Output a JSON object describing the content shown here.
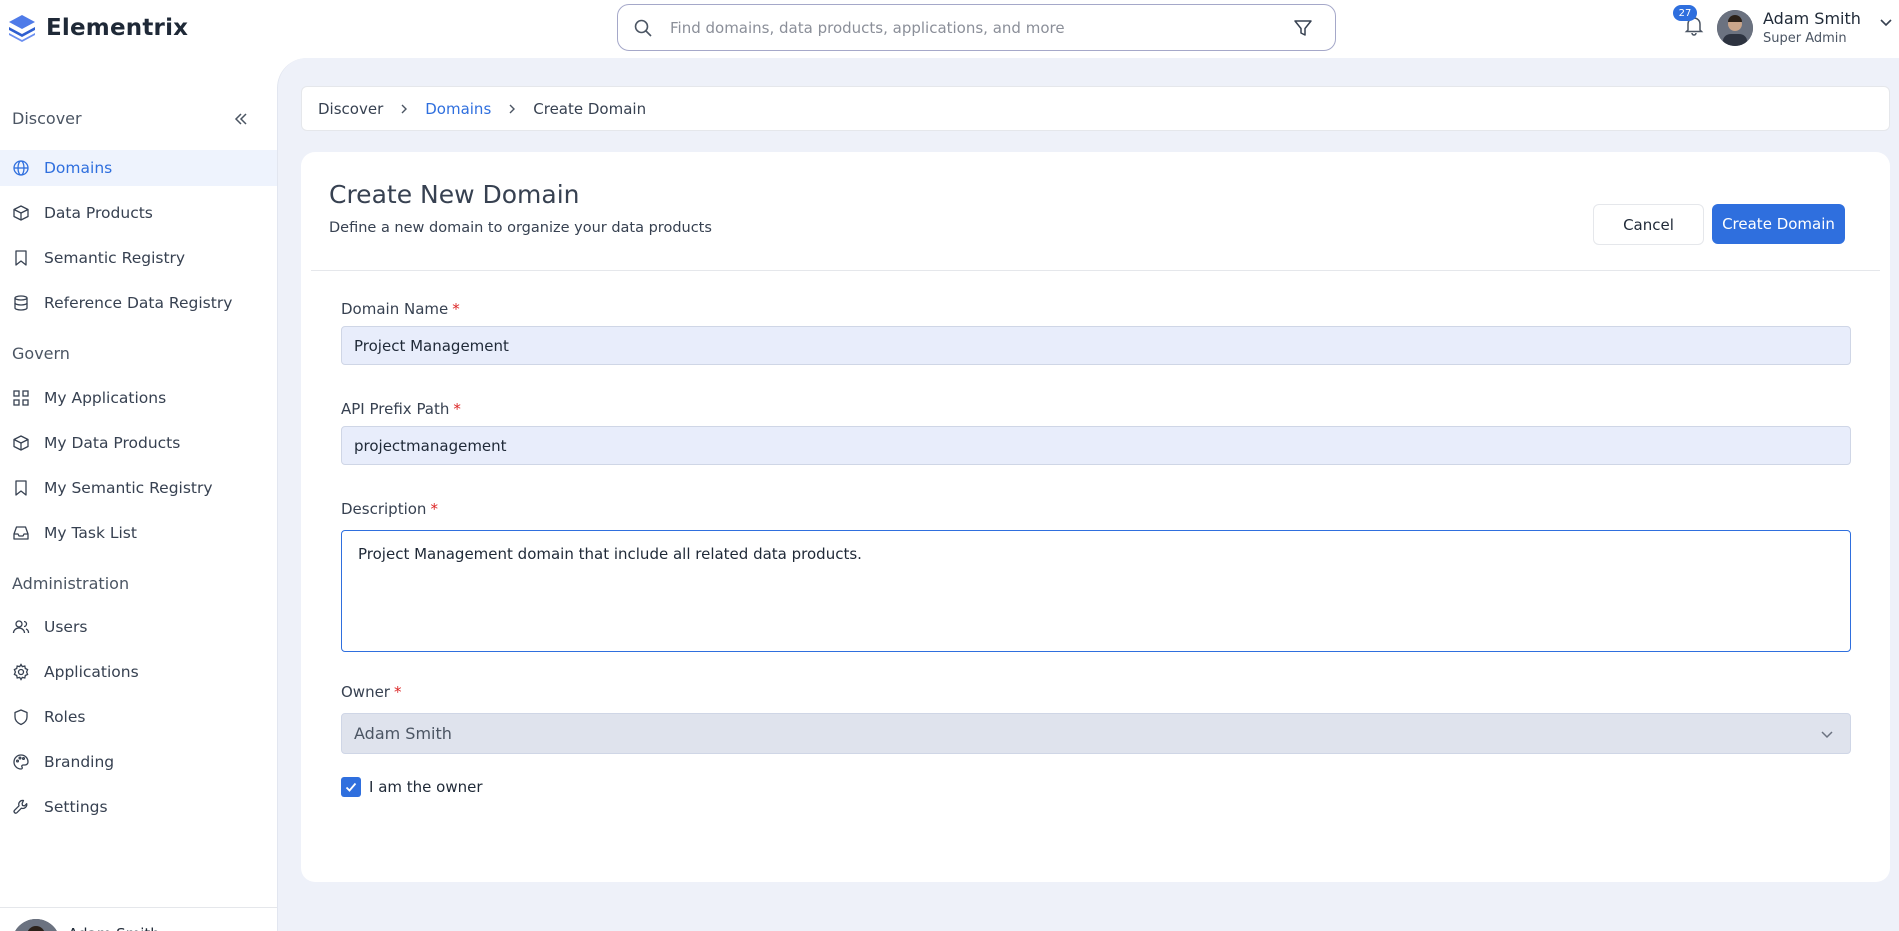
{
  "app": {
    "name": "Elementrix"
  },
  "search": {
    "placeholder": "Find domains, data products, applications, and more"
  },
  "notifications": {
    "count": "27"
  },
  "user": {
    "name": "Adam Smith",
    "role": "Super Admin"
  },
  "sidebar": {
    "sections": [
      {
        "title": "Discover",
        "items": [
          {
            "label": "Domains",
            "icon": "globe-icon",
            "active": true
          },
          {
            "label": "Data Products",
            "icon": "cube-icon"
          },
          {
            "label": "Semantic Registry",
            "icon": "bookmark-icon"
          },
          {
            "label": "Reference Data Registry",
            "icon": "database-icon"
          }
        ]
      },
      {
        "title": "Govern",
        "items": [
          {
            "label": "My Applications",
            "icon": "grid-icon"
          },
          {
            "label": "My Data Products",
            "icon": "cube-icon"
          },
          {
            "label": "My Semantic Registry",
            "icon": "bookmark-icon"
          },
          {
            "label": "My Task List",
            "icon": "inbox-icon"
          }
        ]
      },
      {
        "title": "Administration",
        "items": [
          {
            "label": "Users",
            "icon": "users-icon"
          },
          {
            "label": "Applications",
            "icon": "gear-icon"
          },
          {
            "label": "Roles",
            "icon": "shield-icon"
          },
          {
            "label": "Branding",
            "icon": "palette-icon"
          },
          {
            "label": "Settings",
            "icon": "wrench-icon"
          }
        ]
      }
    ]
  },
  "breadcrumb": [
    "Discover",
    "Domains",
    "Create Domain"
  ],
  "form": {
    "title": "Create New Domain",
    "subtitle": "Define a new domain to organize your data products",
    "cancel_label": "Cancel",
    "submit_label": "Create Domain",
    "required_mark": "*",
    "domain_name": {
      "label": "Domain Name",
      "value": "Project Management"
    },
    "api_prefix": {
      "label": "API Prefix Path",
      "value": "projectmanagement"
    },
    "description": {
      "label": "Description",
      "value": "Project Management domain that include all related data products."
    },
    "owner": {
      "label": "Owner",
      "value": "Adam Smith"
    },
    "owner_checkbox": {
      "label": "I am the owner",
      "checked": true
    }
  },
  "colors": {
    "accent": "#2f6fde",
    "main_bg": "#eef1f9",
    "input_bg": "#e8edfb",
    "required": "#dc2626"
  }
}
